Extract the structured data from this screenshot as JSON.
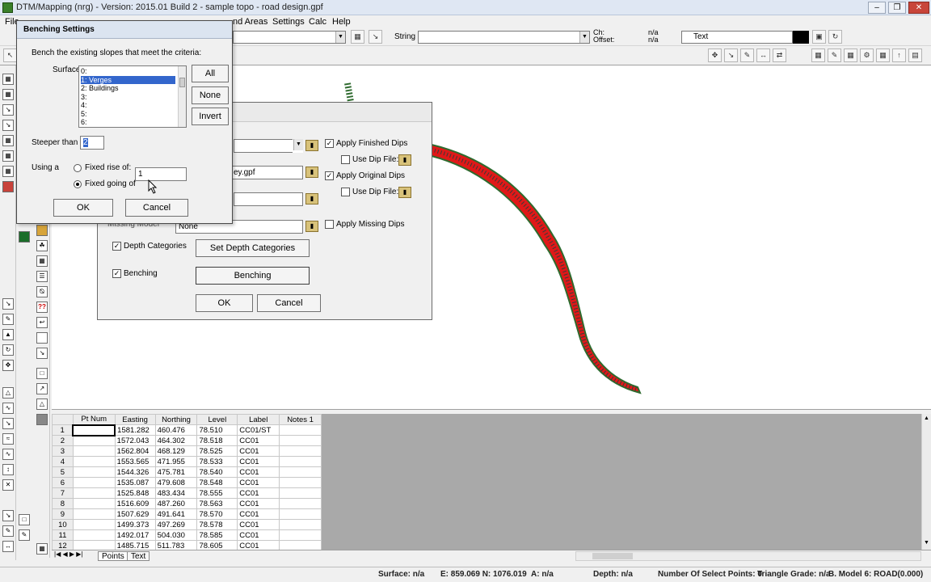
{
  "window": {
    "title": "DTM/Mapping (nrg) - Version: 2015.01 Build 2 - sample topo - road design.gpf"
  },
  "menu": {
    "file": "File",
    "areas": "nd Areas",
    "settings": "Settings",
    "calc": "Calc",
    "help": "Help"
  },
  "toolbar": {
    "string_label": "String",
    "ch_label": "Ch:",
    "offset_label": "Offset:",
    "ch_value": "n/a",
    "offset_value": "n/a",
    "text_combo": "Text"
  },
  "bench_dialog": {
    "title": "Benching Settings",
    "instruction": "Bench the existing slopes that meet the criteria:",
    "surface_label": "Surface:",
    "surfaces": [
      "0:",
      "1: Verges",
      "2: Buildings",
      "3:",
      "4:",
      "5:",
      "6:"
    ],
    "selected_surface": "1: Verges",
    "btn_all": "All",
    "btn_none": "None",
    "btn_invert": "Invert",
    "steeper_label": "Steeper than 1:",
    "steeper_value": "2",
    "using_label": "Using a",
    "fixed_rise_label": "Fixed rise of:",
    "fixed_going_label": "Fixed going of",
    "going_value": "1",
    "ok": "OK",
    "cancel": "Cancel"
  },
  "back_dialog": {
    "file_value": "ey.gpf",
    "missing_model_label": "Missing Model",
    "missing_model_value": "None",
    "apply_finished_dips": "Apply Finished Dips",
    "use_dip_file_1": "Use Dip File:",
    "apply_original_dips": "Apply Original Dips",
    "use_dip_file_2": "Use Dip File:",
    "apply_missing_dips": "Apply Missing Dips",
    "depth_categories": "Depth Categories",
    "set_depth_categories": "Set Depth Categories",
    "benching_label": "Benching",
    "benching_button": "Benching",
    "ok": "OK",
    "cancel": "Cancel"
  },
  "grid": {
    "columns": [
      "Pt Num",
      "Easting",
      "Northing",
      "Level",
      "Label",
      "Notes 1"
    ],
    "rows": [
      [
        "1",
        "",
        "1581.282",
        "460.476",
        "78.510",
        "CC01/ST"
      ],
      [
        "2",
        "",
        "1572.043",
        "464.302",
        "78.518",
        "CC01"
      ],
      [
        "3",
        "",
        "1562.804",
        "468.129",
        "78.525",
        "CC01"
      ],
      [
        "4",
        "",
        "1553.565",
        "471.955",
        "78.533",
        "CC01"
      ],
      [
        "5",
        "",
        "1544.326",
        "475.781",
        "78.540",
        "CC01"
      ],
      [
        "6",
        "",
        "1535.087",
        "479.608",
        "78.548",
        "CC01"
      ],
      [
        "7",
        "",
        "1525.848",
        "483.434",
        "78.555",
        "CC01"
      ],
      [
        "8",
        "",
        "1516.609",
        "487.260",
        "78.563",
        "CC01"
      ],
      [
        "9",
        "",
        "1507.629",
        "491.641",
        "78.570",
        "CC01"
      ],
      [
        "10",
        "",
        "1499.373",
        "497.269",
        "78.578",
        "CC01"
      ],
      [
        "11",
        "",
        "1492.017",
        "504.030",
        "78.585",
        "CC01"
      ],
      [
        "12",
        "",
        "1485.715",
        "511.783",
        "78.605",
        "CC01"
      ]
    ]
  },
  "tabs": {
    "points": "Points",
    "text": "Text"
  },
  "status": {
    "surface": "Surface: n/a",
    "coords": "E: 859.069  N: 1076.019",
    "angle": "A: n/a",
    "depth": "Depth: n/a",
    "select_points": "Number Of Select Points: 0",
    "triangle_grade": "Triangle Grade: n/a",
    "model": "B. Model 6: ROAD(0.000)"
  },
  "colors": {
    "road_fill": "#e01818",
    "road_edge": "#2e6a2e",
    "selection": "#3366cc"
  }
}
